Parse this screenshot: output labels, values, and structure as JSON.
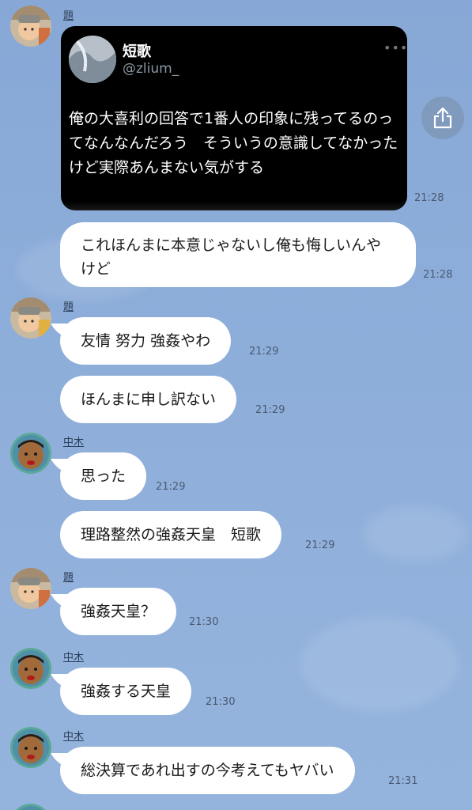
{
  "tweet": {
    "name": "短歌",
    "handle": "@zlium_",
    "more": "•••",
    "text": "俺の大喜利の回答で1番人の印象に残ってるのってなんなんだろう　そういうの意識してなかったけど実際あんまない気がする",
    "time": "21:28"
  },
  "messages": [
    {
      "sender": "題",
      "text": "これほんまに本意じゃないし俺も悔しいんやけど",
      "time": "21:28"
    },
    {
      "sender": "題",
      "text": "友情 努力 強姦やわ",
      "time": "21:29"
    },
    {
      "sender": "題",
      "text": "ほんまに申し訳ない",
      "time": "21:29"
    },
    {
      "sender": "中木",
      "text": "思った",
      "time": "21:29"
    },
    {
      "sender": "中木",
      "text": "理路整然の強姦天皇　短歌",
      "time": "21:29"
    },
    {
      "sender": "題",
      "text": "強姦天皇？",
      "time": "21:30"
    },
    {
      "sender": "中木",
      "text": "強姦する天皇",
      "time": "21:30"
    },
    {
      "sender": "中木",
      "text": "総決算であれ出すの今考えてもヤバい",
      "time": "21:31"
    }
  ],
  "senders": {
    "a": "題",
    "b": "中木"
  },
  "colors": {
    "background": "#8CABD8",
    "bubble": "#ffffff",
    "tweet_bg": "#000000"
  }
}
